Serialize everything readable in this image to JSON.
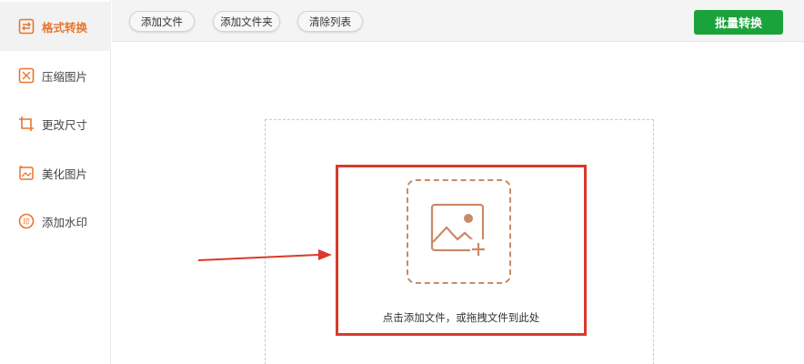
{
  "sidebar": {
    "items": [
      {
        "label": "格式转换",
        "icon": "format-convert-icon",
        "active": true
      },
      {
        "label": "压缩图片",
        "icon": "compress-icon",
        "active": false
      },
      {
        "label": "更改尺寸",
        "icon": "resize-icon",
        "active": false
      },
      {
        "label": "美化图片",
        "icon": "beautify-icon",
        "active": false
      },
      {
        "label": "添加水印",
        "icon": "watermark-icon",
        "active": false
      }
    ]
  },
  "toolbar": {
    "add_file": "添加文件",
    "add_folder": "添加文件夹",
    "clear_list": "清除列表",
    "batch_convert": "批量转换"
  },
  "dropzone": {
    "hint": "点击添加文件，或拖拽文件到此处",
    "icon": "image-add-icon"
  },
  "colors": {
    "accent": "#e8752e",
    "primary_button": "#1aa33a",
    "highlight_border": "#d93a2b",
    "arrow": "#d93a2b"
  }
}
